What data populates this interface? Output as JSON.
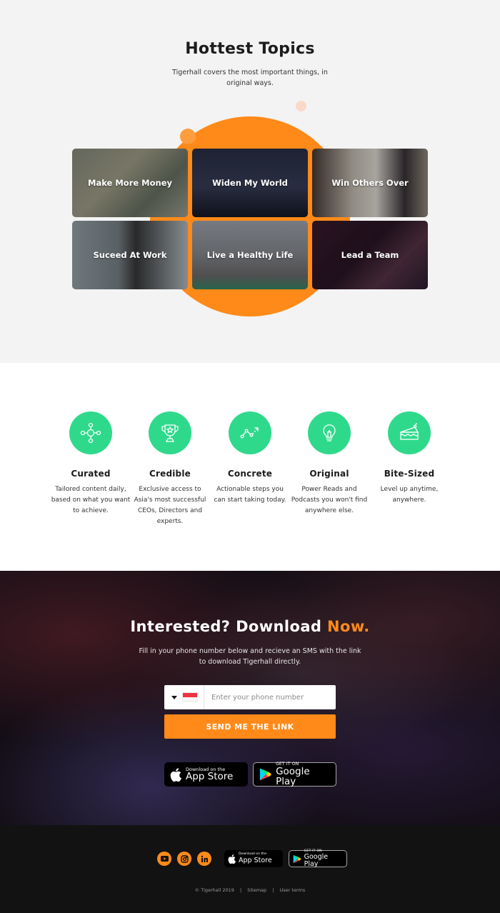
{
  "topics": {
    "title": "Hottest Topics",
    "subtitle": "Tigerhall covers the most important things, in original ways.",
    "tiles": [
      {
        "label": "Make More Money"
      },
      {
        "label": "Widen My World"
      },
      {
        "label": "Win Others Over"
      },
      {
        "label": "Suceed At Work"
      },
      {
        "label": "Live a Healthy Life"
      },
      {
        "label": "Lead a Team"
      }
    ],
    "accent_color": "#ff8a1a"
  },
  "features": {
    "icon_color": "#2fd98c",
    "items": [
      {
        "icon": "network-icon",
        "title": "Curated",
        "text": "Tailored content daily, based on what you want to achieve."
      },
      {
        "icon": "trophy-icon",
        "title": "Credible",
        "text": "Exclusive access to Asia's most successful CEOs, Directors and experts."
      },
      {
        "icon": "trend-arrow-icon",
        "title": "Concrete",
        "text": "Actionable steps you can start taking today."
      },
      {
        "icon": "lightbulb-icon",
        "title": "Original",
        "text": "Power Reads and Podcasts you won't find anywhere else."
      },
      {
        "icon": "cake-slice-icon",
        "title": "Bite-Sized",
        "text": "Level up anytime, anywhere."
      }
    ]
  },
  "download": {
    "title_main": "Interested? Download ",
    "title_accent": "Now.",
    "description": "Fill in your phone number below and recieve an SMS with the link to download Tigerhall directly.",
    "phone": {
      "country_flag": "Singapore",
      "value": "",
      "placeholder": "Enter your phone number"
    },
    "send_label": "SEND ME THE LINK",
    "app_store": {
      "small": "Download on the",
      "big": "App Store"
    },
    "google_play": {
      "small": "GET IT ON",
      "big": "Google Play"
    }
  },
  "footer": {
    "social": [
      "youtube-icon",
      "instagram-icon",
      "linkedin-icon"
    ],
    "app_store": {
      "small": "Download on the",
      "big": "App Store"
    },
    "google_play": {
      "small": "GET IT ON",
      "big": "Google Play"
    },
    "copyright": "© Tigerhall 2019",
    "links": [
      "Sitemap",
      "User terms"
    ],
    "separator": "|"
  }
}
